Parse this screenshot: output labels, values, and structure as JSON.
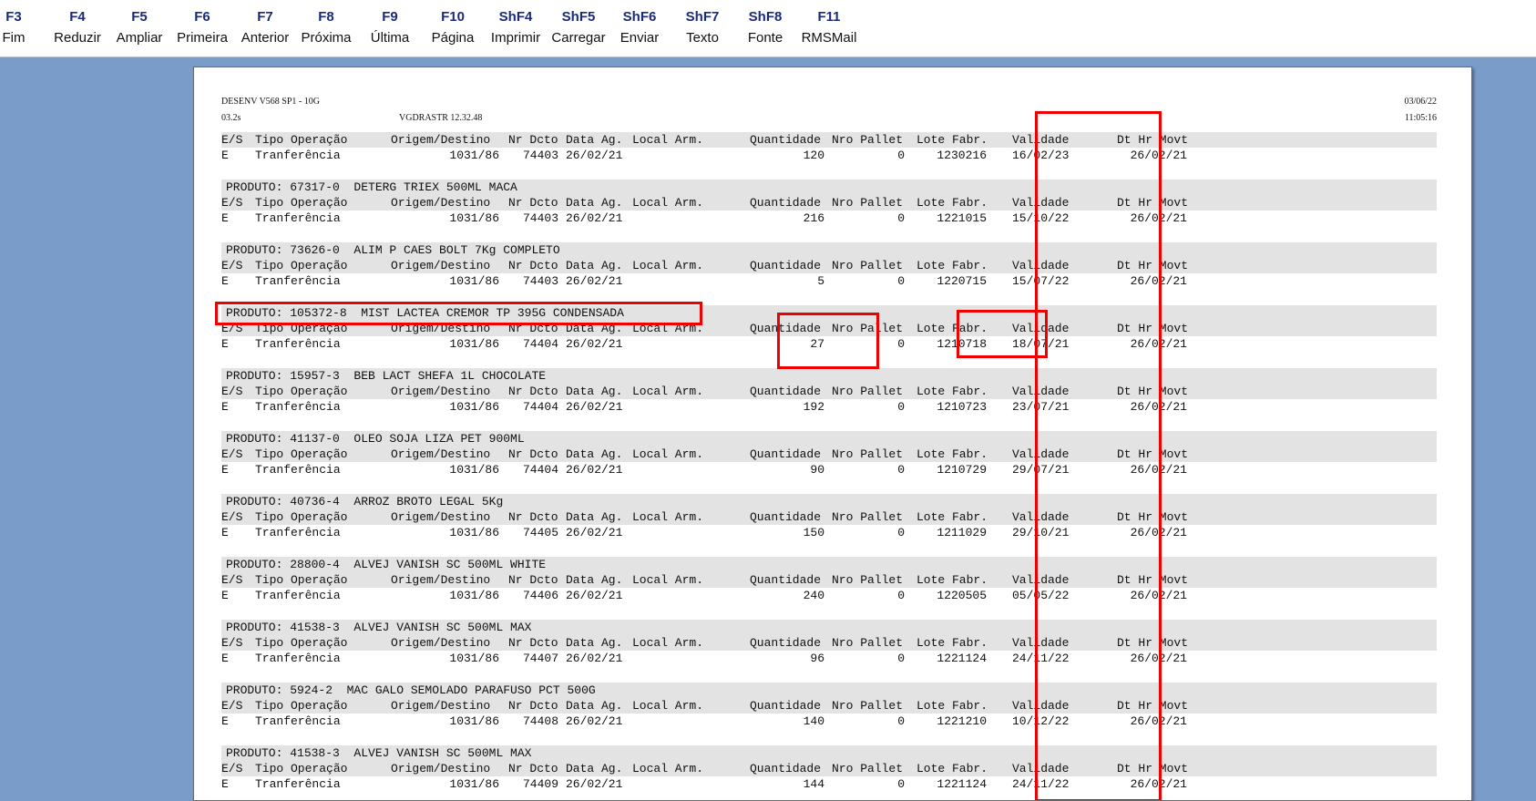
{
  "toolbar": {
    "buttons": [
      {
        "key": "F3",
        "label": "Fim"
      },
      {
        "key": "F4",
        "label": "Reduzir"
      },
      {
        "key": "F5",
        "label": "Ampliar"
      },
      {
        "key": "F6",
        "label": "Primeira"
      },
      {
        "key": "F7",
        "label": "Anterior"
      },
      {
        "key": "F8",
        "label": "Próxima"
      },
      {
        "key": "F9",
        "label": "Última"
      },
      {
        "key": "F10",
        "label": "Página"
      },
      {
        "key": "ShF4",
        "label": "Imprimir"
      },
      {
        "key": "ShF5",
        "label": "Carregar"
      },
      {
        "key": "ShF6",
        "label": "Enviar"
      },
      {
        "key": "ShF7",
        "label": "Texto"
      },
      {
        "key": "ShF8",
        "label": "Fonte"
      },
      {
        "key": "F11",
        "label": "RMSMail"
      }
    ]
  },
  "report": {
    "header": {
      "system": "DESENV V568 SP1 - 10G",
      "version": "03.2s",
      "program": "VGDRASTR 12.32.48",
      "date": "03/06/22",
      "time": "11:05:16"
    },
    "columns": {
      "es": "E/S",
      "tipo": "Tipo Operação",
      "origem": "Origem/Destino",
      "nrdcto": "Nr Dcto",
      "dataag": "Data Ag.",
      "local": "Local Arm.",
      "qtd": "Quantidade",
      "pallet": "Nro Pallet",
      "lote": "Lote Fabr.",
      "validade": "Validade",
      "dthr": "Dt Hr Movt"
    },
    "groups": [
      {
        "produto": "",
        "es": "E",
        "tipo": "Tranferência",
        "origem": "1031/86",
        "nrdcto": "74403",
        "dataag": "26/02/21",
        "qtd": "120",
        "pallet": "0",
        "lote": "1230216",
        "validade": "16/02/23",
        "dthr": "26/02/21"
      },
      {
        "produto": "PRODUTO: 67317-0  DETERG TRIEX 500ML MACA",
        "es": "E",
        "tipo": "Tranferência",
        "origem": "1031/86",
        "nrdcto": "74403",
        "dataag": "26/02/21",
        "qtd": "216",
        "pallet": "0",
        "lote": "1221015",
        "validade": "15/10/22",
        "dthr": "26/02/21"
      },
      {
        "produto": "PRODUTO: 73626-0  ALIM P CAES BOLT 7Kg COMPLETO",
        "es": "E",
        "tipo": "Tranferência",
        "origem": "1031/86",
        "nrdcto": "74403",
        "dataag": "26/02/21",
        "qtd": "5",
        "pallet": "0",
        "lote": "1220715",
        "validade": "15/07/22",
        "dthr": "26/02/21"
      },
      {
        "produto": "PRODUTO: 105372-8  MIST LACTEA CREMOR TP 395G CONDENSADA",
        "es": "E",
        "tipo": "Tranferência",
        "origem": "1031/86",
        "nrdcto": "74404",
        "dataag": "26/02/21",
        "qtd": "27",
        "pallet": "0",
        "lote": "1210718",
        "validade": "18/07/21",
        "dthr": "26/02/21"
      },
      {
        "produto": "PRODUTO: 15957-3  BEB LACT SHEFA 1L CHOCOLATE",
        "es": "E",
        "tipo": "Tranferência",
        "origem": "1031/86",
        "nrdcto": "74404",
        "dataag": "26/02/21",
        "qtd": "192",
        "pallet": "0",
        "lote": "1210723",
        "validade": "23/07/21",
        "dthr": "26/02/21"
      },
      {
        "produto": "PRODUTO: 41137-0  OLEO SOJA LIZA PET 900ML",
        "es": "E",
        "tipo": "Tranferência",
        "origem": "1031/86",
        "nrdcto": "74404",
        "dataag": "26/02/21",
        "qtd": "90",
        "pallet": "0",
        "lote": "1210729",
        "validade": "29/07/21",
        "dthr": "26/02/21"
      },
      {
        "produto": "PRODUTO: 40736-4  ARROZ BROTO LEGAL 5Kg",
        "es": "E",
        "tipo": "Tranferência",
        "origem": "1031/86",
        "nrdcto": "74405",
        "dataag": "26/02/21",
        "qtd": "150",
        "pallet": "0",
        "lote": "1211029",
        "validade": "29/10/21",
        "dthr": "26/02/21"
      },
      {
        "produto": "PRODUTO: 28800-4  ALVEJ VANISH SC 500ML WHITE",
        "es": "E",
        "tipo": "Tranferência",
        "origem": "1031/86",
        "nrdcto": "74406",
        "dataag": "26/02/21",
        "qtd": "240",
        "pallet": "0",
        "lote": "1220505",
        "validade": "05/05/22",
        "dthr": "26/02/21"
      },
      {
        "produto": "PRODUTO: 41538-3  ALVEJ VANISH SC 500ML MAX",
        "es": "E",
        "tipo": "Tranferência",
        "origem": "1031/86",
        "nrdcto": "74407",
        "dataag": "26/02/21",
        "qtd": "96",
        "pallet": "0",
        "lote": "1221124",
        "validade": "24/11/22",
        "dthr": "26/02/21"
      },
      {
        "produto": "PRODUTO: 5924-2  MAC GALO SEMOLADO PARAFUSO PCT 500G",
        "es": "E",
        "tipo": "Tranferência",
        "origem": "1031/86",
        "nrdcto": "74408",
        "dataag": "26/02/21",
        "qtd": "140",
        "pallet": "0",
        "lote": "1221210",
        "validade": "10/12/22",
        "dthr": "26/02/21"
      },
      {
        "produto": "PRODUTO: 41538-3  ALVEJ VANISH SC 500ML MAX",
        "es": "E",
        "tipo": "Tranferência",
        "origem": "1031/86",
        "nrdcto": "74409",
        "dataag": "26/02/21",
        "qtd": "144",
        "pallet": "0",
        "lote": "1221124",
        "validade": "24/11/22",
        "dthr": "26/02/21"
      }
    ]
  },
  "colors": {
    "background": "#7a9cc9",
    "highlight": "#ee0000",
    "row_shade": "#e3e3e3"
  }
}
